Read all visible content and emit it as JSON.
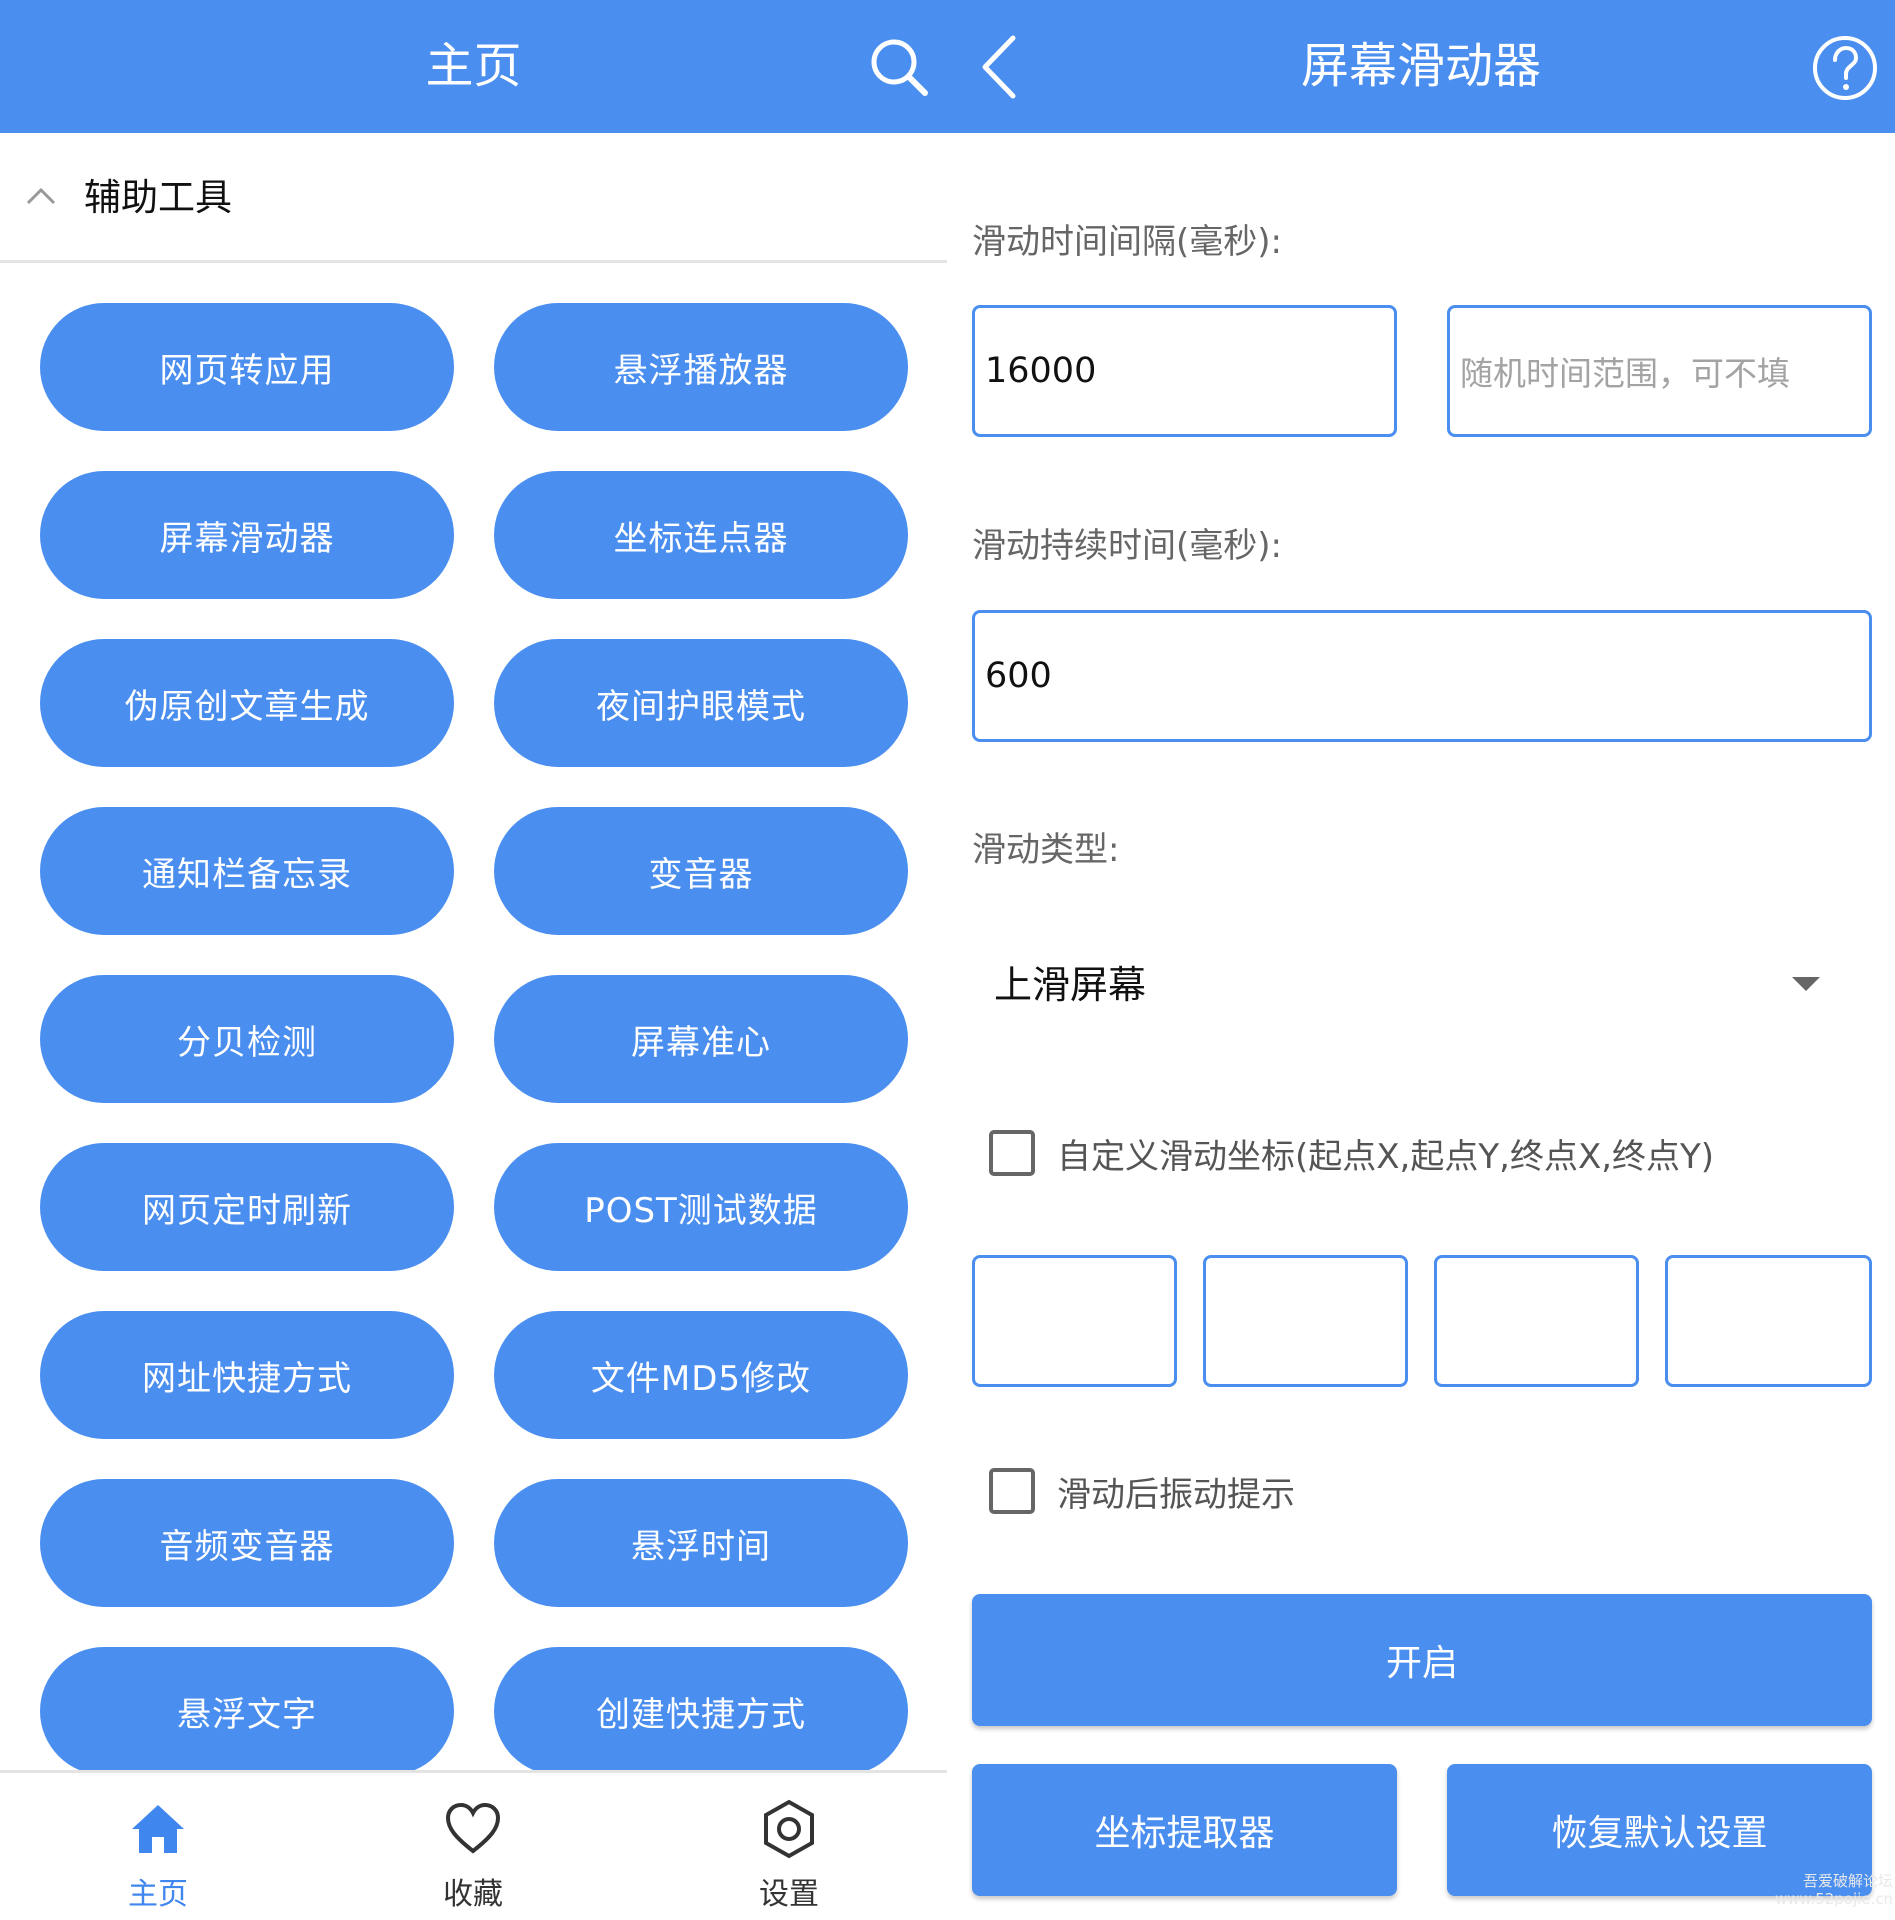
{
  "left": {
    "title": "主页",
    "section_title": "辅助工具",
    "tools": [
      "网页转应用",
      "悬浮播放器",
      "屏幕滑动器",
      "坐标连点器",
      "伪原创文章生成",
      "夜间护眼模式",
      "通知栏备忘录",
      "变音器",
      "分贝检测",
      "屏幕准心",
      "网页定时刷新",
      "POST测试数据",
      "网址快捷方式",
      "文件MD5修改",
      "音频变音器",
      "悬浮时间",
      "悬浮文字",
      "创建快捷方式"
    ],
    "nav": [
      {
        "label": "主页",
        "icon": "home-icon",
        "active": true
      },
      {
        "label": "收藏",
        "icon": "heart-icon",
        "active": false
      },
      {
        "label": "设置",
        "icon": "settings-icon",
        "active": false
      }
    ]
  },
  "right": {
    "title": "屏幕滑动器",
    "interval_label": "滑动时间间隔(毫秒):",
    "interval_value": "16000",
    "random_placeholder": "随机时间范围，可不填",
    "duration_label": "滑动持续时间(毫秒):",
    "duration_value": "600",
    "type_label": "滑动类型:",
    "type_value": "上滑屏幕",
    "custom_coords_label": "自定义滑动坐标(起点X,起点Y,终点X,终点Y)",
    "vibrate_label": "滑动后振动提示",
    "start_button": "开启",
    "picker_button": "坐标提取器",
    "reset_button": "恢复默认设置"
  },
  "watermark": "吾爱破解论坛\nwww.52pojie.cn",
  "colors": {
    "primary": "#4a8ef0",
    "nav_active": "#3f86ee"
  }
}
